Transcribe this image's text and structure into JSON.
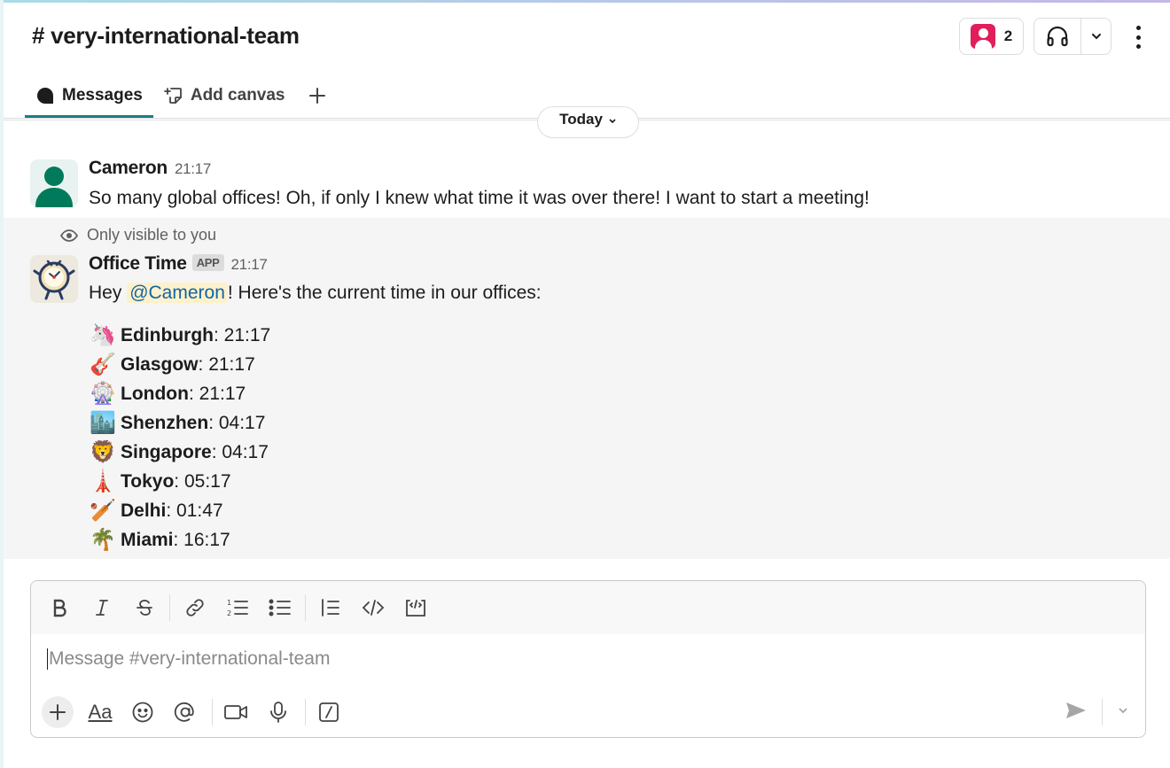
{
  "header": {
    "channel_title": "# very-international-team",
    "member_count": "2"
  },
  "tabs": [
    {
      "label": "Messages",
      "active": true
    },
    {
      "label": "Add canvas",
      "active": false
    }
  ],
  "date_divider": "Today",
  "messages": [
    {
      "author": "Cameron",
      "time": "21:17",
      "text": "So many global offices! Oh, if only I knew what time it was over there! I want to start a meeting!"
    },
    {
      "visibility_note": "Only visible to you",
      "author": "Office Time",
      "badge": "APP",
      "time": "21:17",
      "text_before": "Hey ",
      "mention": "@Cameron",
      "text_after": "! Here's the current time in our offices:",
      "cities": [
        {
          "emoji": "🦄",
          "name": "Edinburgh",
          "time": ": 21:17"
        },
        {
          "emoji": "🎸",
          "name": "Glasgow",
          "time": ": 21:17"
        },
        {
          "emoji": "🎡",
          "name": "London",
          "time": ": 21:17"
        },
        {
          "emoji": "🏙️",
          "name": "Shenzhen",
          "time": ": 04:17"
        },
        {
          "emoji": "🦁",
          "name": "Singapore",
          "time": ": 04:17"
        },
        {
          "emoji": "🗼",
          "name": "Tokyo",
          "time": ": 05:17"
        },
        {
          "emoji": "🏏",
          "name": "Delhi",
          "time": ": 01:47"
        },
        {
          "emoji": "🌴",
          "name": "Miami",
          "time": ": 16:17"
        }
      ]
    }
  ],
  "composer": {
    "placeholder": "Message #very-international-team",
    "font_button": "Aa"
  },
  "colors": {
    "accent": "#1a7f86",
    "mention_bg": "#fdf1cc",
    "mention_text": "#1264a3",
    "avatar_green": "#007a5a",
    "members_avatar": "#e01e5a"
  }
}
